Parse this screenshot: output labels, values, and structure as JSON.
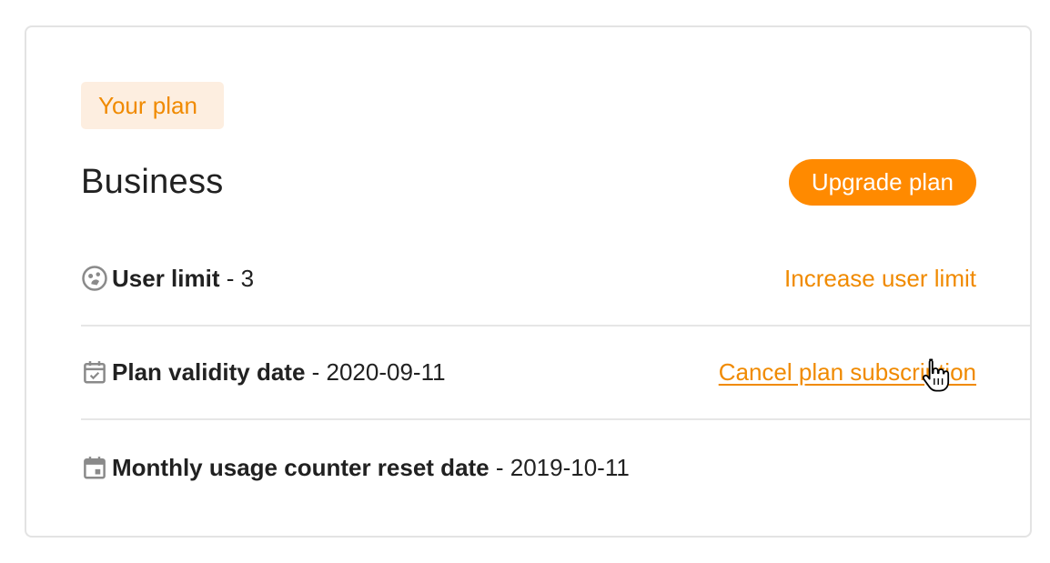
{
  "plan_card": {
    "badge": "Your plan",
    "plan_name": "Business",
    "upgrade_label": "Upgrade plan"
  },
  "rows": [
    {
      "icon": "user-face-icon",
      "label": "User limit",
      "separator": " - ",
      "value": "3",
      "action": "Increase user limit"
    },
    {
      "icon": "calendar-check-icon",
      "label": "Plan validity date",
      "separator": " - ",
      "value": "2020-09-11",
      "action": "Cancel plan subscription"
    },
    {
      "icon": "calendar-icon",
      "label": "Monthly usage counter reset date",
      "separator": " - ",
      "value": "2019-10-11"
    }
  ],
  "colors": {
    "accent": "#ff8a00",
    "accent_text": "#f08a00",
    "badge_bg": "#fdeee0",
    "text": "#212121",
    "icon": "#8a8a8a",
    "divider": "#e6e6e6"
  }
}
